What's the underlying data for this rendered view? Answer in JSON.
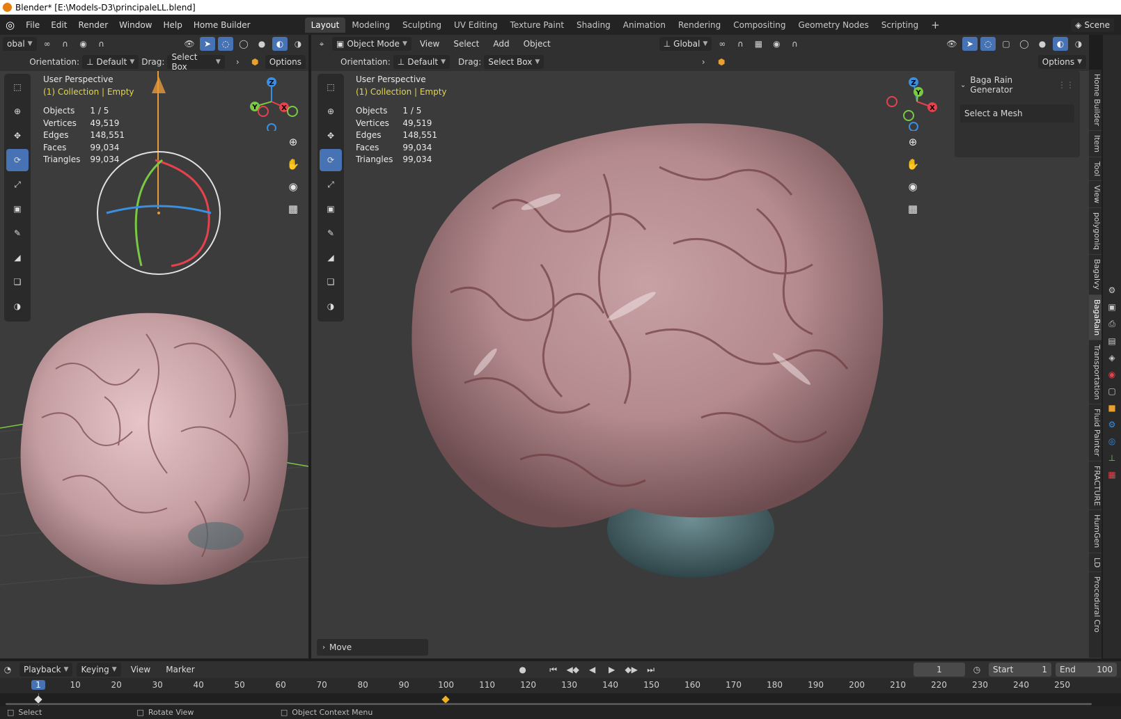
{
  "window_title": "Blender* [E:\\Models-D3\\principaleLL.blend]",
  "menus": [
    "File",
    "Edit",
    "Render",
    "Window",
    "Help",
    "Home Builder"
  ],
  "workspaces": [
    "Layout",
    "Modeling",
    "Sculpting",
    "UV Editing",
    "Texture Paint",
    "Shading",
    "Animation",
    "Rendering",
    "Compositing",
    "Geometry Nodes",
    "Scripting"
  ],
  "active_workspace": "Layout",
  "scene_label": "Scene",
  "left_view": {
    "global_label": "obal",
    "orientation_label": "Orientation:",
    "orientation_value": "Default",
    "drag_label": "Drag:",
    "drag_value": "Select Box",
    "options_label": "Options",
    "perspective": "User Perspective",
    "collection": "(1) Collection | Empty"
  },
  "right_view": {
    "mode": "Object Mode",
    "menus": [
      "View",
      "Select",
      "Add",
      "Object"
    ],
    "transform": "Global",
    "orientation_label": "Orientation:",
    "orientation_value": "Default",
    "drag_label": "Drag:",
    "drag_value": "Select Box",
    "options_label": "Options",
    "perspective": "User Perspective",
    "collection": "(1) Collection | Empty",
    "last_op": "Move"
  },
  "stats": {
    "rows": [
      {
        "label": "Objects",
        "value": "1 / 5"
      },
      {
        "label": "Vertices",
        "value": "49,519"
      },
      {
        "label": "Edges",
        "value": "148,551"
      },
      {
        "label": "Faces",
        "value": "99,034"
      },
      {
        "label": "Triangles",
        "value": "99,034"
      }
    ]
  },
  "gizmo_axes": [
    "X",
    "Y",
    "Z"
  ],
  "npanel": {
    "title": "Baga Rain Generator",
    "field": "Select a Mesh",
    "tabs": [
      "Home Builder",
      "Item",
      "Tool",
      "View",
      "polygoniq",
      "Bagalvy",
      "BagaRain",
      "Transportation",
      "Fluid Painter",
      "FRACTURE",
      "HumGen",
      "LD",
      "Procedural Cro"
    ],
    "active_tab": "BagaRain"
  },
  "timeline": {
    "menus": [
      "Playback",
      "Keying",
      "View",
      "Marker"
    ],
    "current_frame": "1",
    "start_label": "Start",
    "start": "1",
    "end_label": "End",
    "end": "100",
    "ticks": [
      "1",
      "10",
      "20",
      "30",
      "40",
      "50",
      "60",
      "70",
      "80",
      "90",
      "100",
      "110",
      "120",
      "130",
      "140",
      "150",
      "160",
      "170",
      "180",
      "190",
      "200",
      "210",
      "220",
      "230",
      "240",
      "250"
    ]
  },
  "statusbar": [
    "Select",
    "Rotate View",
    "Object Context Menu"
  ],
  "colors": {
    "accent": "#4772b3",
    "axis_x": "#e5424d",
    "axis_y": "#7ac943",
    "axis_z": "#3b8fe0",
    "keyframe": "#f0b020"
  }
}
